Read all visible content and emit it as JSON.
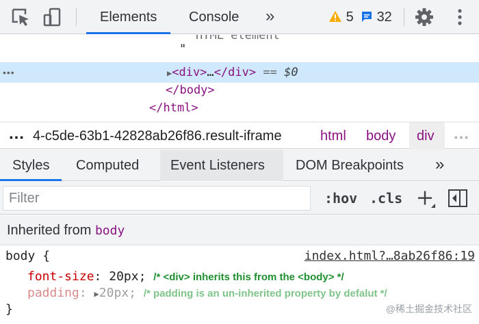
{
  "toolbar": {
    "tabs": [
      {
        "label": "Elements"
      },
      {
        "label": "Console"
      }
    ],
    "more_tabs": "»",
    "warnings_count": "5",
    "messages_count": "32",
    "colors": {
      "accent": "#1a73e8",
      "warning": "#f9ab00",
      "message": "#1a73e8"
    }
  },
  "dom": {
    "cut_text": "HTML element",
    "quote": "\"",
    "selected": {
      "open": "<div>",
      "ellipsis": "…",
      "close": "</div>",
      "eq": "==",
      "ref": "$0"
    },
    "line_dots": "•••",
    "body_close": "</body>",
    "html_close": "</html>"
  },
  "breadcrumbs": {
    "dots_left": "…",
    "id_part": "4-c5de-63b1-42828ab26f86",
    "class_part": ".result-iframe",
    "items": [
      {
        "label": "html"
      },
      {
        "label": "body"
      },
      {
        "label": "div"
      }
    ],
    "dots_right": "…"
  },
  "subtabs": {
    "items": [
      {
        "label": "Styles"
      },
      {
        "label": "Computed"
      },
      {
        "label": "Event Listeners"
      },
      {
        "label": "DOM Breakpoints"
      }
    ],
    "more": "»"
  },
  "filter": {
    "placeholder": "Filter",
    "hov": ":hov",
    "cls": ".cls"
  },
  "inherited": {
    "prefix": "Inherited from",
    "tag": "body"
  },
  "rule": {
    "selector": "body",
    "open_brace": "{",
    "close_brace": "}",
    "source": "index.html?…8ab26f86:19",
    "props": [
      {
        "name": "font-size",
        "value": "20px",
        "comment": "/* <div> inherits this from the <body> */"
      },
      {
        "name": "padding",
        "value": "20px",
        "comment": "/* padding is an un-inherited  property by defalut */"
      }
    ]
  },
  "watermark": "@稀土掘金技术社区"
}
